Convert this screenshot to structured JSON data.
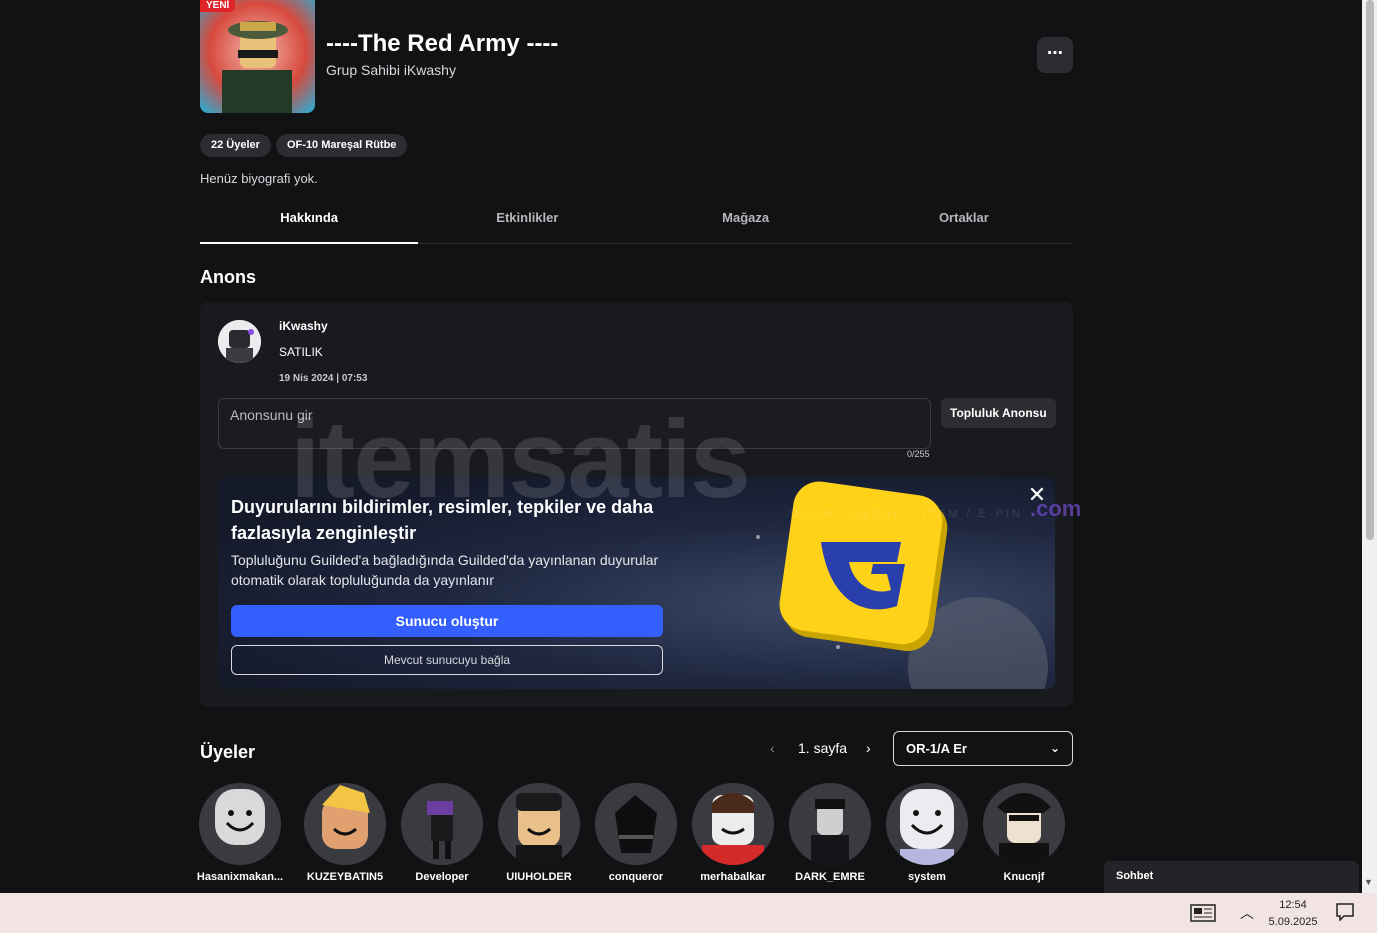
{
  "group": {
    "new_badge": "YENİ",
    "title": "----The Red Army ----",
    "owner": "Grup Sahibi iKwashy",
    "more_icon": "⋯",
    "tags": [
      "22 Üyeler",
      "OF-10 Mareşal Rütbe"
    ],
    "bio": "Henüz biyografi yok."
  },
  "tabs": [
    "Hakkında",
    "Etkinlikler",
    "Mağaza",
    "Ortaklar"
  ],
  "announcement": {
    "section_title": "Anons",
    "author": "iKwashy",
    "text": "SATILIK",
    "date": "19 Nis 2024 | 07:53",
    "input_placeholder": "Anonsunu gir",
    "counter": "0/255",
    "community_button": "Topluluk Anonsu"
  },
  "promo": {
    "title": "Duyurularını bildirimler, resimler, tepkiler ve daha fazlasıyla zenginleştir",
    "description": "Topluluğunu Guilded'a bağladığında Guilded'da yayınlanan duyurular otomatik olarak topluluğunda da yayınlanır",
    "create_button": "Sunucu oluştur",
    "link_button": "Mevcut sunucuyu bağla"
  },
  "members": {
    "section_title": "Üyeler",
    "page_label": "1. sayfa",
    "rank_selected": "OR-1/A Er",
    "list": [
      "Hasanixmakan...",
      "KUZEYBATIN5",
      "Developer",
      "UIUHOLDER",
      "conqueror",
      "merhabalkar",
      "DARK_EMRE",
      "system",
      "Knucnjf"
    ]
  },
  "watermark": {
    "brand": "itemsatis",
    "suffix": ".com",
    "tagline": "OYUN / HESAP / ITEM / E-PIN"
  },
  "chat": {
    "label": "Sohbet"
  },
  "taskbar": {
    "time": "12:54",
    "date": "5.09.2025"
  },
  "colors": {
    "background": "#111214",
    "card": "#191a1d",
    "accent": "#335fff",
    "badge": "#e0242a"
  }
}
